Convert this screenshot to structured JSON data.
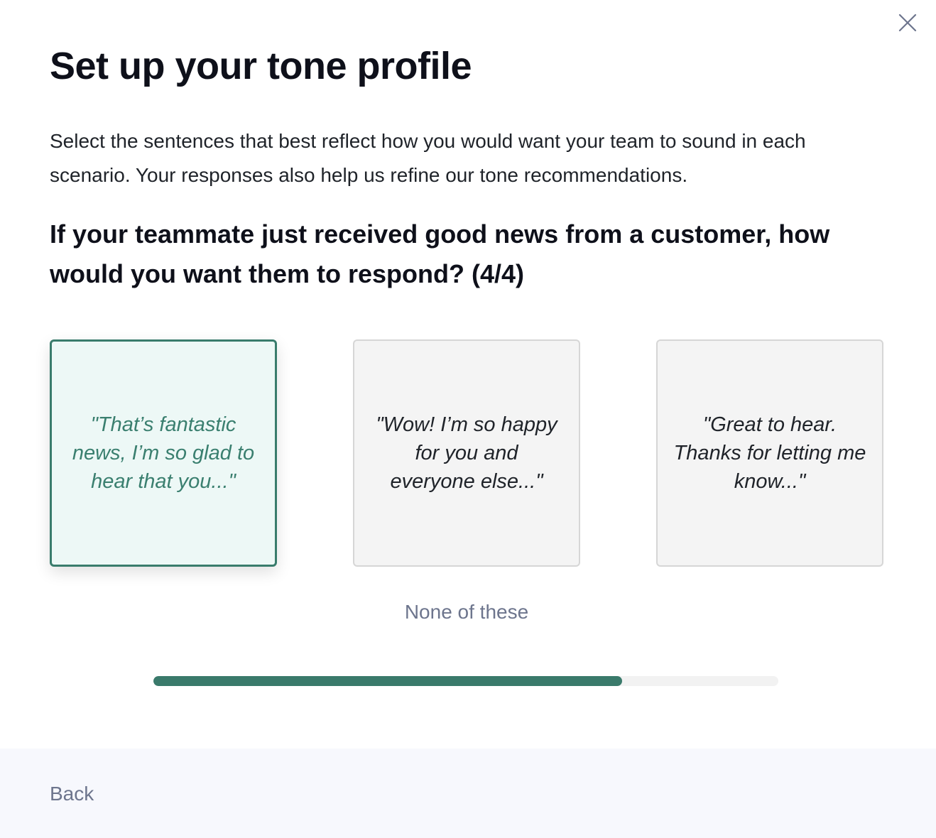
{
  "dialog": {
    "title": "Set up your tone profile",
    "description": "Select the sentences that best reflect how you would want your team to sound in each scenario. Your responses also help us refine our tone recommendations.",
    "question": "If your teammate just received good news from a customer, how would you want them to respond? (4/4)",
    "close_icon": "close-icon"
  },
  "options": [
    {
      "text": "\"That’s fantastic news, I’m so glad to hear that you...\"",
      "selected": true
    },
    {
      "text": "\"Wow! I’m so happy for you and everyone else...\"",
      "selected": false
    },
    {
      "text": "\"Great to hear. Thanks for letting me know...\"",
      "selected": false
    }
  ],
  "none_label": "None of these",
  "progress": {
    "fraction": 0.75
  },
  "footer": {
    "back_label": "Back"
  },
  "colors": {
    "accent": "#3a7a6b",
    "selected_bg": "#edf8f6",
    "card_bg": "#f4f4f4",
    "footer_bg": "#f7f8fd",
    "muted_text": "#6d758d"
  }
}
